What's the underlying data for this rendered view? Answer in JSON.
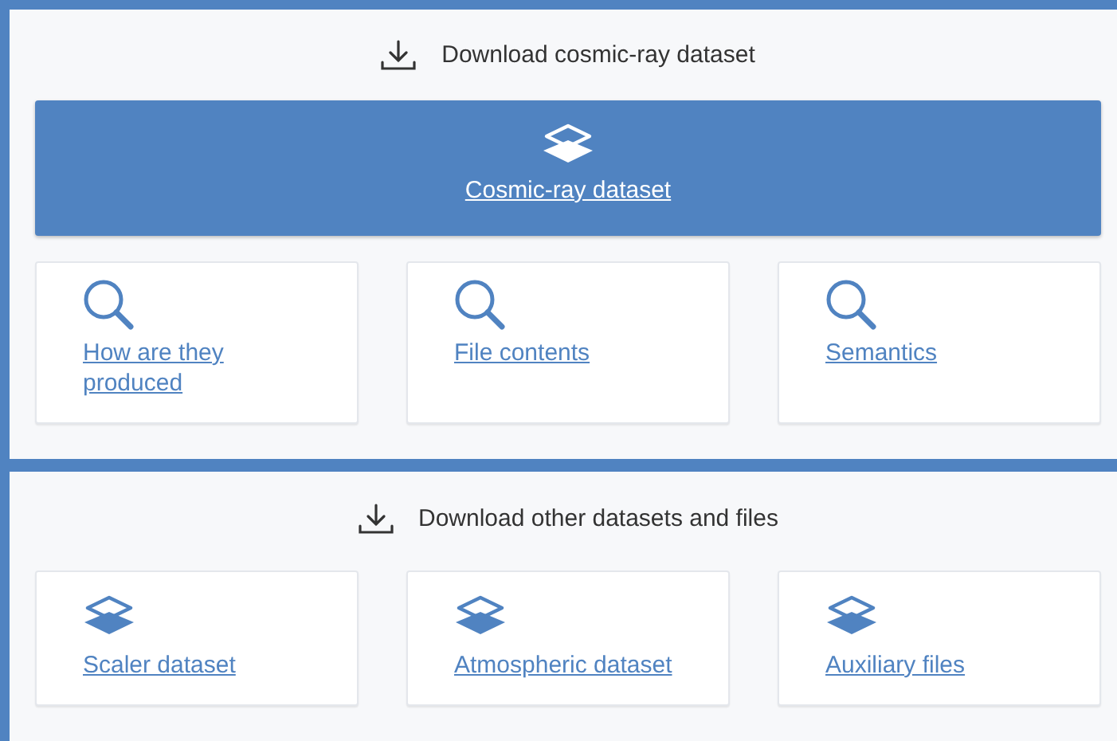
{
  "sections": [
    {
      "heading": "Download cosmic-ray dataset",
      "featured": {
        "label": "Cosmic-ray dataset",
        "kind": "layers"
      },
      "cards": [
        {
          "label": "How are they produced",
          "kind": "search"
        },
        {
          "label": "File contents",
          "kind": "search"
        },
        {
          "label": "Semantics",
          "kind": "search"
        }
      ]
    },
    {
      "heading": "Download other datasets and files",
      "cards": [
        {
          "label": "Scaler dataset",
          "kind": "layers"
        },
        {
          "label": "Atmospheric dataset",
          "kind": "layers"
        },
        {
          "label": "Auxiliary files",
          "kind": "layers"
        }
      ]
    }
  ]
}
